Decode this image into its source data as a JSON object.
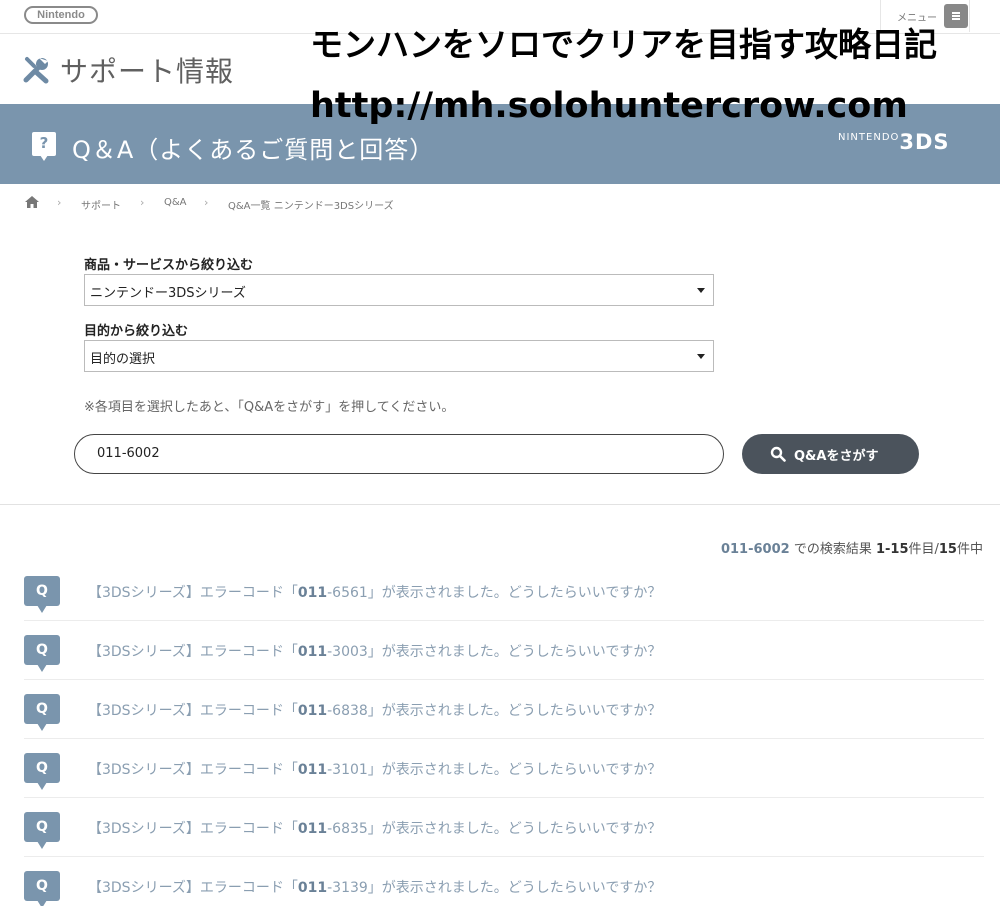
{
  "header": {
    "logo": "Nintendo",
    "menu_label": "メニュー"
  },
  "support": {
    "title": "サポート情報"
  },
  "overlay": {
    "line1": "モンハンをソロでクリアを目指す攻略日記",
    "line2": "http://mh.solohuntercrow.com"
  },
  "banner": {
    "title": "Q＆A（よくあるご質問と回答）",
    "brand_small": "NINTENDO",
    "brand_big": "3DS"
  },
  "breadcrumb": [
    "サポート",
    "Q&A",
    "Q&A一覧 ニンテンドー3DSシリーズ"
  ],
  "filters": {
    "product_label": "商品・サービスから絞り込む",
    "product_value": "ニンテンドー3DSシリーズ",
    "purpose_label": "目的から絞り込む",
    "purpose_value": "目的の選択",
    "note": "※各項目を選択したあと、「Q&Aをさがす」を押してください。"
  },
  "search": {
    "value": "011-6002",
    "button_label": "Q&Aをさがす"
  },
  "results_summary": {
    "keyword": "011-6002",
    "text1": " での検索結果 ",
    "range": "1-15",
    "text2": "件目/",
    "total": "15",
    "text3": "件中"
  },
  "results": [
    {
      "badge": "Q",
      "prefix": "【3DSシリーズ】エラーコード「",
      "code": "011",
      "code_rest": "-6561",
      "suffix": "」が表示されました。どうしたらいいですか？"
    },
    {
      "badge": "Q",
      "prefix": "【3DSシリーズ】エラーコード「",
      "code": "011",
      "code_rest": "-3003",
      "suffix": "」が表示されました。どうしたらいいですか？"
    },
    {
      "badge": "Q",
      "prefix": "【3DSシリーズ】エラーコード「",
      "code": "011",
      "code_rest": "-6838",
      "suffix": "」が表示されました。どうしたらいいですか？"
    },
    {
      "badge": "Q",
      "prefix": "【3DSシリーズ】エラーコード「",
      "code": "011",
      "code_rest": "-3101",
      "suffix": "」が表示されました。どうしたらいいですか？"
    },
    {
      "badge": "Q",
      "prefix": "【3DSシリーズ】エラーコード「",
      "code": "011",
      "code_rest": "-6835",
      "suffix": "」が表示されました。どうしたらいいですか？"
    },
    {
      "badge": "Q",
      "prefix": "【3DSシリーズ】エラーコード「",
      "code": "011",
      "code_rest": "-3139",
      "suffix": "」が表示されました。どうしたらいいですか？"
    }
  ],
  "colors": {
    "banner": "#7a95ad",
    "search_button": "#4b535c",
    "result_text": "#8a9eb1"
  }
}
